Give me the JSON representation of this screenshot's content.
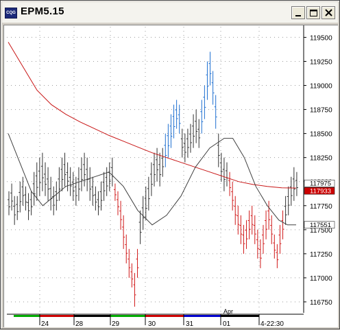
{
  "window": {
    "title": "EPM5.15",
    "icon": "cqg-app-icon",
    "buttons": [
      "minimize-icon",
      "maximize-icon",
      "close-icon"
    ]
  },
  "colors": {
    "up_trend": "#1e6fd0",
    "down_trend": "#d01818",
    "neutral": "#303030",
    "ma_long": "#c81414",
    "ma_short": "#404040",
    "current_price_box": "#cc0000"
  },
  "chart_data": {
    "type": "bar",
    "title": "",
    "y_ticks": [
      "119500",
      "119250",
      "119000",
      "118750",
      "118500",
      "118250",
      "118000",
      "117750",
      "117500",
      "117250",
      "117000",
      "116750"
    ],
    "y_values": [
      119500,
      119250,
      119000,
      118750,
      118500,
      118250,
      118000,
      117750,
      117500,
      117250,
      117000,
      116750
    ],
    "ylim": [
      116650,
      119610
    ],
    "x_ticks": [
      "24",
      "28",
      "29",
      "30",
      "31",
      "01",
      "4-22:30"
    ],
    "month_label": "Apr",
    "price_labels": {
      "last": "117975",
      "ma_long": "117933",
      "ma_short": "117551"
    },
    "session_colors": [
      "#00aa00",
      "#cc0000",
      "#000000",
      "#00aa00",
      "#cc0000",
      "#0000cc",
      "#000000"
    ],
    "bars": {
      "neutral_1": [
        [
          117650,
          117900
        ],
        [
          117700,
          117980
        ],
        [
          117550,
          117850
        ],
        [
          117600,
          117850
        ],
        [
          117680,
          118000
        ],
        [
          117750,
          118050
        ],
        [
          117700,
          117950
        ],
        [
          117600,
          117880
        ],
        [
          117650,
          117900
        ],
        [
          117750,
          118100
        ],
        [
          117800,
          118200
        ],
        [
          117850,
          118250
        ],
        [
          117900,
          118300
        ],
        [
          117850,
          118200
        ],
        [
          117800,
          118150
        ],
        [
          117700,
          118050
        ],
        [
          117650,
          117950
        ],
        [
          117700,
          118000
        ],
        [
          117800,
          118150
        ],
        [
          117900,
          118250
        ],
        [
          117950,
          118300
        ],
        [
          117900,
          118200
        ],
        [
          117850,
          118150
        ],
        [
          117800,
          118100
        ],
        [
          117750,
          118050
        ],
        [
          117800,
          118150
        ],
        [
          117900,
          118250
        ],
        [
          117950,
          118300
        ],
        [
          117900,
          118250
        ],
        [
          117800,
          118150
        ],
        [
          117750,
          118050
        ],
        [
          117700,
          117950
        ],
        [
          117650,
          117900
        ],
        [
          117700,
          118000
        ],
        [
          117800,
          118100
        ],
        [
          117850,
          118150
        ],
        [
          117900,
          118200
        ],
        [
          117950,
          118250
        ]
      ],
      "red_1": [
        [
          117800,
          117980
        ],
        [
          117650,
          117900
        ],
        [
          117500,
          117800
        ],
        [
          117300,
          117650
        ],
        [
          117150,
          117450
        ],
        [
          117000,
          117300
        ],
        [
          116900,
          117150
        ],
        [
          116700,
          117050
        ],
        [
          117000,
          117300
        ]
      ],
      "neutral_2": [
        [
          117350,
          117700
        ],
        [
          117500,
          117850
        ],
        [
          117600,
          117950
        ],
        [
          117700,
          118050
        ],
        [
          117850,
          118200
        ],
        [
          117950,
          118300
        ],
        [
          118000,
          118350
        ],
        [
          117950,
          118300
        ],
        [
          118050,
          118350
        ]
      ],
      "blue_1": [
        [
          118150,
          118500
        ],
        [
          118250,
          118600
        ],
        [
          118350,
          118700
        ],
        [
          118450,
          118800
        ],
        [
          118550,
          118850
        ],
        [
          118500,
          118800
        ]
      ],
      "neutral_3": [
        [
          118250,
          118550
        ],
        [
          118200,
          118500
        ],
        [
          118250,
          118550
        ],
        [
          118300,
          118600
        ],
        [
          118350,
          118700
        ],
        [
          118400,
          118750
        ],
        [
          118350,
          118650
        ]
      ],
      "blue_2": [
        [
          118500,
          118850
        ],
        [
          118650,
          119000
        ],
        [
          118850,
          119250
        ],
        [
          119000,
          119350
        ],
        [
          118800,
          119150
        ],
        [
          118550,
          118900
        ]
      ],
      "neutral_4": [
        [
          118150,
          118500
        ],
        [
          118000,
          118300
        ],
        [
          117900,
          118250
        ],
        [
          117950,
          118200
        ]
      ],
      "red_2": [
        [
          117850,
          118100
        ],
        [
          117700,
          118000
        ],
        [
          117550,
          117850
        ],
        [
          117450,
          117750
        ],
        [
          117350,
          117650
        ],
        [
          117250,
          117550
        ],
        [
          117300,
          117600
        ],
        [
          117400,
          117700
        ],
        [
          117450,
          117750
        ],
        [
          117350,
          117650
        ],
        [
          117200,
          117500
        ],
        [
          117100,
          117400
        ],
        [
          117250,
          117550
        ],
        [
          117400,
          117700
        ],
        [
          117500,
          117800
        ],
        [
          117350,
          117650
        ],
        [
          117200,
          117450
        ],
        [
          117100,
          117350
        ],
        [
          117250,
          117550
        ],
        [
          117400,
          117700
        ]
      ],
      "neutral_5": [
        [
          117550,
          117850
        ],
        [
          117650,
          117950
        ],
        [
          117750,
          118050
        ],
        [
          117800,
          118150
        ],
        [
          117850,
          118100
        ]
      ]
    },
    "ma_long": [
      [
        0,
        119450
      ],
      [
        0.05,
        119200
      ],
      [
        0.1,
        118950
      ],
      [
        0.15,
        118800
      ],
      [
        0.2,
        118700
      ],
      [
        0.25,
        118620
      ],
      [
        0.3,
        118550
      ],
      [
        0.35,
        118480
      ],
      [
        0.4,
        118420
      ],
      [
        0.45,
        118360
      ],
      [
        0.5,
        118300
      ],
      [
        0.55,
        118250
      ],
      [
        0.6,
        118200
      ],
      [
        0.65,
        118150
      ],
      [
        0.7,
        118100
      ],
      [
        0.75,
        118050
      ],
      [
        0.8,
        118000
      ],
      [
        0.85,
        117970
      ],
      [
        0.9,
        117950
      ],
      [
        0.95,
        117935
      ],
      [
        1,
        117933
      ]
    ],
    "ma_short": [
      [
        0,
        118500
      ],
      [
        0.04,
        118200
      ],
      [
        0.08,
        117900
      ],
      [
        0.12,
        117750
      ],
      [
        0.16,
        117850
      ],
      [
        0.2,
        117950
      ],
      [
        0.25,
        118000
      ],
      [
        0.3,
        118050
      ],
      [
        0.35,
        118100
      ],
      [
        0.4,
        117950
      ],
      [
        0.45,
        117700
      ],
      [
        0.5,
        117550
      ],
      [
        0.55,
        117650
      ],
      [
        0.6,
        117850
      ],
      [
        0.65,
        118150
      ],
      [
        0.7,
        118350
      ],
      [
        0.75,
        118450
      ],
      [
        0.78,
        118450
      ],
      [
        0.82,
        118250
      ],
      [
        0.86,
        117950
      ],
      [
        0.9,
        117750
      ],
      [
        0.94,
        117600
      ],
      [
        0.97,
        117550
      ],
      [
        1,
        117551
      ]
    ]
  }
}
